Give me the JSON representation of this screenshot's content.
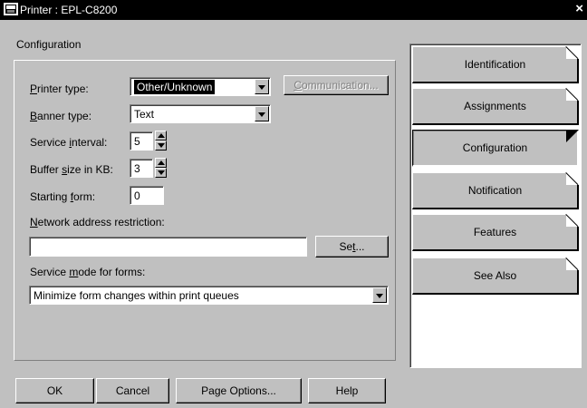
{
  "window": {
    "title": "Printer : EPL-C8200",
    "close_glyph": "×"
  },
  "panel": {
    "title": "Configuration",
    "printer_type": {
      "label_pre": "",
      "label_key": "P",
      "label_post": "rinter type:",
      "value": "Other/Unknown"
    },
    "communication_button": {
      "label_pre": "",
      "label_key": "C",
      "label_post": "ommunication..."
    },
    "banner_type": {
      "label_pre": "",
      "label_key": "B",
      "label_post": "anner type:",
      "value": "Text"
    },
    "service_interval": {
      "label_pre": "Service ",
      "label_key": "i",
      "label_post": "nterval:",
      "value": "5"
    },
    "buffer_size": {
      "label_pre": "Buffer ",
      "label_key": "s",
      "label_post": "ize in KB:",
      "value": "3"
    },
    "starting_form": {
      "label_pre": "Starting ",
      "label_key": "f",
      "label_post": "orm:",
      "value": "0"
    },
    "network_restriction": {
      "label_pre": "",
      "label_key": "N",
      "label_post": "etwork address restriction:",
      "value": ""
    },
    "set_button": {
      "label_pre": "Se",
      "label_key": "t",
      "label_post": "..."
    },
    "service_mode": {
      "label_pre": "Service ",
      "label_key": "m",
      "label_post": "ode for forms:",
      "value": "Minimize form changes within print queues"
    }
  },
  "buttons": {
    "ok": "OK",
    "cancel": "Cancel",
    "page_options": "Page Options...",
    "help": "Help"
  },
  "tabs": [
    {
      "label": "Identification",
      "active": false
    },
    {
      "label": "Assignments",
      "active": false
    },
    {
      "label": "Configuration",
      "active": true
    },
    {
      "label": "Notification",
      "active": false
    },
    {
      "label": "Features",
      "active": false
    },
    {
      "label": "See Also",
      "active": false
    }
  ],
  "icons": {
    "title_icon": "printer-icon",
    "close_icon": "close-icon"
  }
}
